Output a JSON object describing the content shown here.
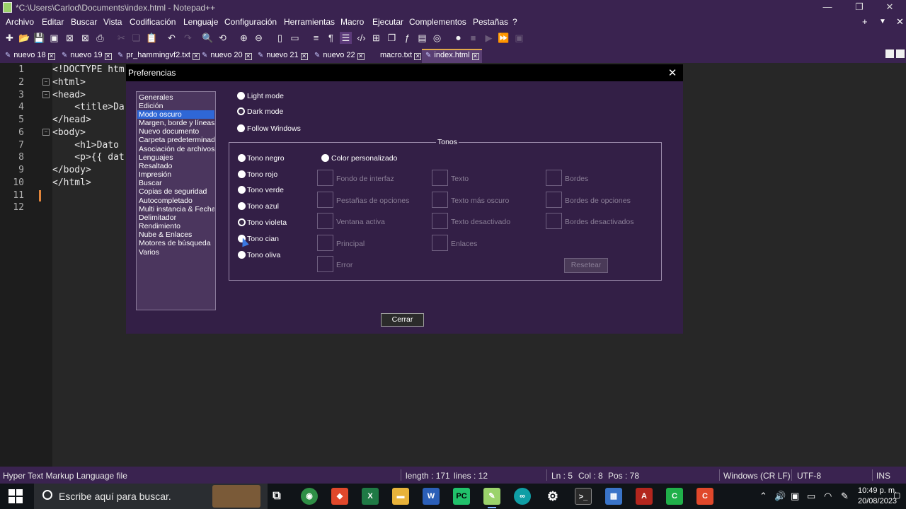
{
  "window": {
    "title": "*C:\\Users\\Carlod\\Documents\\index.html - Notepad++",
    "minimize_icon": "minimize-icon",
    "restore_icon": "restore-icon",
    "close_icon": "close-icon"
  },
  "menu": {
    "items": [
      "Archivo",
      "Editar",
      "Buscar",
      "Vista",
      "Codificación",
      "Lenguaje",
      "Configuración",
      "Herramientas",
      "Macro",
      "Ejecutar",
      "Complementos",
      "Pestañas",
      "?"
    ],
    "right_plus": "+",
    "right_down": "▼",
    "right_close": "✕"
  },
  "tabs": [
    {
      "label": "nuevo 18"
    },
    {
      "label": "nuevo 19"
    },
    {
      "label": "pr_hammingvf2.txt"
    },
    {
      "label": "nuevo 20"
    },
    {
      "label": "nuevo 21"
    },
    {
      "label": "nuevo 22"
    },
    {
      "label": "macro.txt"
    },
    {
      "label": "index.html"
    }
  ],
  "editor": {
    "line_numbers": [
      "1",
      "2",
      "3",
      "4",
      "5",
      "6",
      "7",
      "8",
      "9",
      "10",
      "11",
      "12"
    ],
    "lines": [
      "<!DOCTYPE htm",
      "<html>",
      "<head>",
      "    <title>Da",
      "</head>",
      "<body>",
      "    <h1>Dato",
      "    <p>{{ dat",
      "</body>",
      "</html>",
      "",
      ""
    ]
  },
  "dialog": {
    "title": "Preferencias",
    "categories": [
      "Generales",
      "Edición",
      "Modo oscuro",
      "Margen, borde y líneas",
      "Nuevo documento",
      "Carpeta predeterminada",
      "Asociación de archivos",
      "Lenguajes",
      "Resaltado",
      "Impresión",
      "Buscar",
      "Copias de seguridad",
      "Autocompletado",
      "Multi instancia & Fecha",
      "Delimitador",
      "Rendimiento",
      "Nube & Enlaces",
      "Motores de búsqueda",
      "Varios"
    ],
    "modes": [
      "Light mode",
      "Dark mode",
      "Follow Windows"
    ],
    "tonos_title": "Tonos",
    "tones": [
      "Tono negro",
      "Tono rojo",
      "Tono verde",
      "Tono azul",
      "Tono violeta",
      "Tono cian",
      "Tono oliva"
    ],
    "custom_color": "Color personalizado",
    "swatches_col1": [
      "Fondo de interfaz",
      "Pestañas de opciones",
      "Ventana activa",
      "Principal",
      "Error"
    ],
    "swatches_col2": [
      "Texto",
      "Texto más oscuro",
      "Texto desactivado",
      "Enlaces"
    ],
    "swatches_col3": [
      "Bordes",
      "Bordes de opciones",
      "Bordes desactivados"
    ],
    "reset_label": "Resetear",
    "close_label": "Cerrar"
  },
  "status": {
    "file_type": "Hyper Text Markup Language file",
    "length": "length : 171",
    "lines": "lines : 12",
    "ln": "Ln : 5",
    "col": "Col : 8",
    "pos": "Pos : 78",
    "eol": "Windows (CR LF)",
    "encoding": "UTF-8",
    "ins": "INS"
  },
  "taskbar": {
    "search_placeholder": "Escribe aquí para buscar.",
    "time": "10:49 p. m.",
    "date": "20/08/2023"
  },
  "colors": {
    "chrome_purple": "#3a2350",
    "dialog_bg": "#331f46",
    "selection_blue": "#2f67d6"
  }
}
